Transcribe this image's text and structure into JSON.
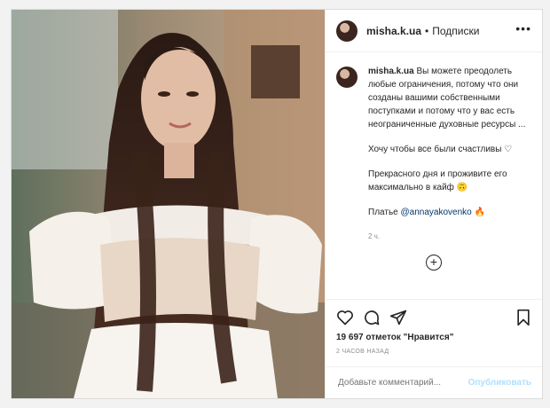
{
  "header": {
    "username": "misha.k.ua",
    "separator": "•",
    "follow_state": "Подписки",
    "more_glyph": "•••"
  },
  "caption": {
    "username": "misha.k.ua",
    "text1": "Вы можете преодолеть любые ограничения, потому что они созданы вашими собственными поступками и потому что у вас есть неограниченные духовные ресурсы ...",
    "text2": "Хочу чтобы все были счастливы ♡",
    "text3": "Прекрасного дня и проживите его максимально в кайф 🙃",
    "text4_prefix": "Платье ",
    "text4_link": "@annayakovenko",
    "text4_suffix": " 🔥",
    "time": "2 ч.",
    "load_more_glyph": "+",
    "comment_peek": "…"
  },
  "stats": {
    "likes": "19 697 отметок \"Нравится\"",
    "posted": "2 ЧАСОВ НАЗАД"
  },
  "comment_box": {
    "placeholder": "Добавьте комментарий...",
    "publish": "Опубликовать"
  },
  "icons": {
    "like": "heart-icon",
    "comment": "comment-icon",
    "share": "share-icon",
    "save": "bookmark-icon"
  }
}
